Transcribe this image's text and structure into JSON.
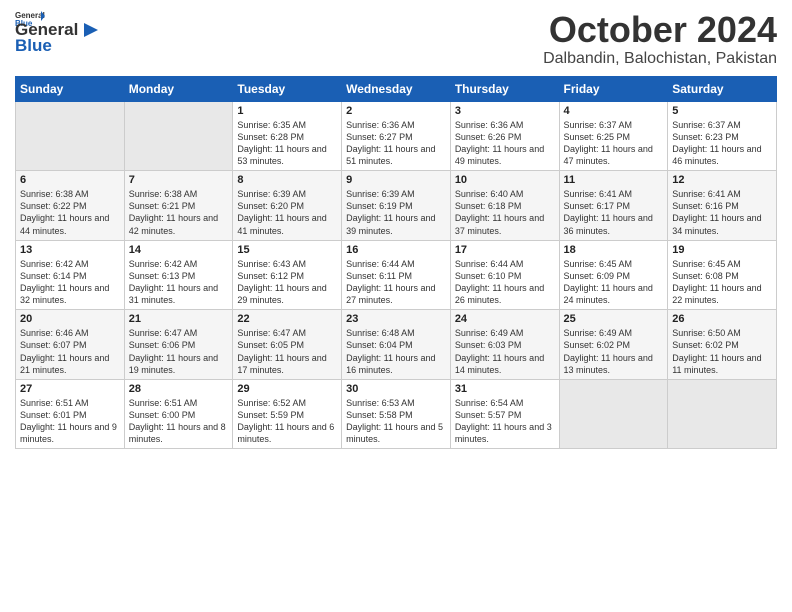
{
  "logo": {
    "line1": "General",
    "line2": "Blue"
  },
  "title": "October 2024",
  "location": "Dalbandin, Balochistan, Pakistan",
  "weekdays": [
    "Sunday",
    "Monday",
    "Tuesday",
    "Wednesday",
    "Thursday",
    "Friday",
    "Saturday"
  ],
  "weeks": [
    [
      {
        "day": "",
        "info": ""
      },
      {
        "day": "",
        "info": ""
      },
      {
        "day": "1",
        "info": "Sunrise: 6:35 AM\nSunset: 6:28 PM\nDaylight: 11 hours\nand 53 minutes."
      },
      {
        "day": "2",
        "info": "Sunrise: 6:36 AM\nSunset: 6:27 PM\nDaylight: 11 hours\nand 51 minutes."
      },
      {
        "day": "3",
        "info": "Sunrise: 6:36 AM\nSunset: 6:26 PM\nDaylight: 11 hours\nand 49 minutes."
      },
      {
        "day": "4",
        "info": "Sunrise: 6:37 AM\nSunset: 6:25 PM\nDaylight: 11 hours\nand 47 minutes."
      },
      {
        "day": "5",
        "info": "Sunrise: 6:37 AM\nSunset: 6:23 PM\nDaylight: 11 hours\nand 46 minutes."
      }
    ],
    [
      {
        "day": "6",
        "info": "Sunrise: 6:38 AM\nSunset: 6:22 PM\nDaylight: 11 hours\nand 44 minutes."
      },
      {
        "day": "7",
        "info": "Sunrise: 6:38 AM\nSunset: 6:21 PM\nDaylight: 11 hours\nand 42 minutes."
      },
      {
        "day": "8",
        "info": "Sunrise: 6:39 AM\nSunset: 6:20 PM\nDaylight: 11 hours\nand 41 minutes."
      },
      {
        "day": "9",
        "info": "Sunrise: 6:39 AM\nSunset: 6:19 PM\nDaylight: 11 hours\nand 39 minutes."
      },
      {
        "day": "10",
        "info": "Sunrise: 6:40 AM\nSunset: 6:18 PM\nDaylight: 11 hours\nand 37 minutes."
      },
      {
        "day": "11",
        "info": "Sunrise: 6:41 AM\nSunset: 6:17 PM\nDaylight: 11 hours\nand 36 minutes."
      },
      {
        "day": "12",
        "info": "Sunrise: 6:41 AM\nSunset: 6:16 PM\nDaylight: 11 hours\nand 34 minutes."
      }
    ],
    [
      {
        "day": "13",
        "info": "Sunrise: 6:42 AM\nSunset: 6:14 PM\nDaylight: 11 hours\nand 32 minutes."
      },
      {
        "day": "14",
        "info": "Sunrise: 6:42 AM\nSunset: 6:13 PM\nDaylight: 11 hours\nand 31 minutes."
      },
      {
        "day": "15",
        "info": "Sunrise: 6:43 AM\nSunset: 6:12 PM\nDaylight: 11 hours\nand 29 minutes."
      },
      {
        "day": "16",
        "info": "Sunrise: 6:44 AM\nSunset: 6:11 PM\nDaylight: 11 hours\nand 27 minutes."
      },
      {
        "day": "17",
        "info": "Sunrise: 6:44 AM\nSunset: 6:10 PM\nDaylight: 11 hours\nand 26 minutes."
      },
      {
        "day": "18",
        "info": "Sunrise: 6:45 AM\nSunset: 6:09 PM\nDaylight: 11 hours\nand 24 minutes."
      },
      {
        "day": "19",
        "info": "Sunrise: 6:45 AM\nSunset: 6:08 PM\nDaylight: 11 hours\nand 22 minutes."
      }
    ],
    [
      {
        "day": "20",
        "info": "Sunrise: 6:46 AM\nSunset: 6:07 PM\nDaylight: 11 hours\nand 21 minutes."
      },
      {
        "day": "21",
        "info": "Sunrise: 6:47 AM\nSunset: 6:06 PM\nDaylight: 11 hours\nand 19 minutes."
      },
      {
        "day": "22",
        "info": "Sunrise: 6:47 AM\nSunset: 6:05 PM\nDaylight: 11 hours\nand 17 minutes."
      },
      {
        "day": "23",
        "info": "Sunrise: 6:48 AM\nSunset: 6:04 PM\nDaylight: 11 hours\nand 16 minutes."
      },
      {
        "day": "24",
        "info": "Sunrise: 6:49 AM\nSunset: 6:03 PM\nDaylight: 11 hours\nand 14 minutes."
      },
      {
        "day": "25",
        "info": "Sunrise: 6:49 AM\nSunset: 6:02 PM\nDaylight: 11 hours\nand 13 minutes."
      },
      {
        "day": "26",
        "info": "Sunrise: 6:50 AM\nSunset: 6:02 PM\nDaylight: 11 hours\nand 11 minutes."
      }
    ],
    [
      {
        "day": "27",
        "info": "Sunrise: 6:51 AM\nSunset: 6:01 PM\nDaylight: 11 hours\nand 9 minutes."
      },
      {
        "day": "28",
        "info": "Sunrise: 6:51 AM\nSunset: 6:00 PM\nDaylight: 11 hours\nand 8 minutes."
      },
      {
        "day": "29",
        "info": "Sunrise: 6:52 AM\nSunset: 5:59 PM\nDaylight: 11 hours\nand 6 minutes."
      },
      {
        "day": "30",
        "info": "Sunrise: 6:53 AM\nSunset: 5:58 PM\nDaylight: 11 hours\nand 5 minutes."
      },
      {
        "day": "31",
        "info": "Sunrise: 6:54 AM\nSunset: 5:57 PM\nDaylight: 11 hours\nand 3 minutes."
      },
      {
        "day": "",
        "info": ""
      },
      {
        "day": "",
        "info": ""
      }
    ]
  ]
}
